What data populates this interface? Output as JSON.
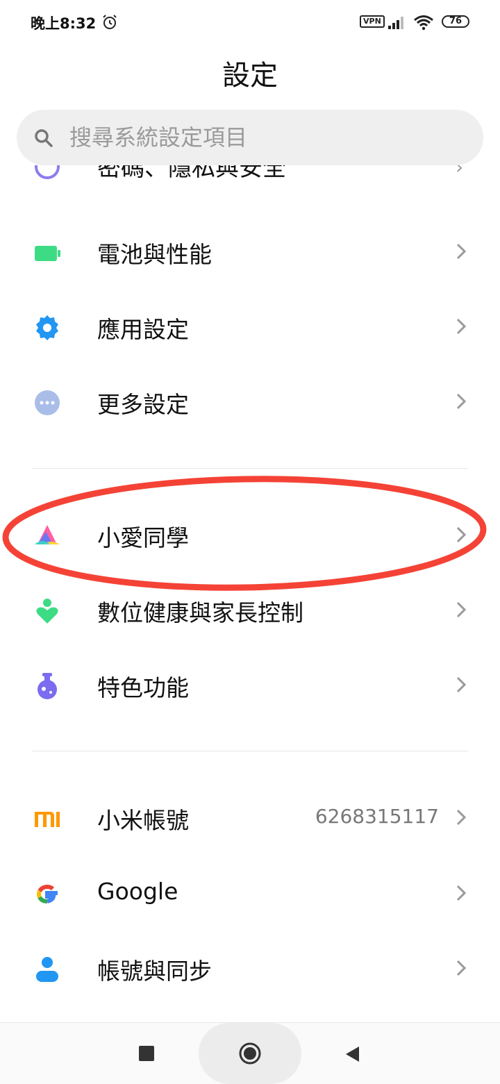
{
  "status_bar": {
    "time": "晚上8:32",
    "vpn": "VPN",
    "battery": "76"
  },
  "header": {
    "title": "設定"
  },
  "search": {
    "placeholder": "搜尋系統設定項目"
  },
  "partial_item": {
    "label": "密碼、隱私與安全"
  },
  "groups": [
    {
      "items": [
        {
          "label": "電池與性能",
          "icon": "battery-icon",
          "color": "#3ddc84"
        },
        {
          "label": "應用設定",
          "icon": "gear-icon",
          "color": "#2196f3"
        },
        {
          "label": "更多設定",
          "icon": "more-dots-icon",
          "color": "#a9bde8"
        }
      ]
    },
    {
      "items": [
        {
          "label": "小愛同學",
          "icon": "xiaoai-icon",
          "highlighted": true
        },
        {
          "label": "數位健康與家長控制",
          "icon": "digital-wellbeing-icon",
          "color": "#3ddc84"
        },
        {
          "label": "特色功能",
          "icon": "flask-icon",
          "color": "#7b6cf0"
        }
      ]
    },
    {
      "items": [
        {
          "label": "小米帳號",
          "value": "6268315117",
          "icon": "mi-logo-icon",
          "color": "#ff9800"
        },
        {
          "label": "Google",
          "icon": "google-icon"
        },
        {
          "label": "帳號與同步",
          "icon": "person-icon",
          "color": "#2196f3"
        }
      ]
    }
  ],
  "annotation": {
    "color": "#f44336"
  }
}
